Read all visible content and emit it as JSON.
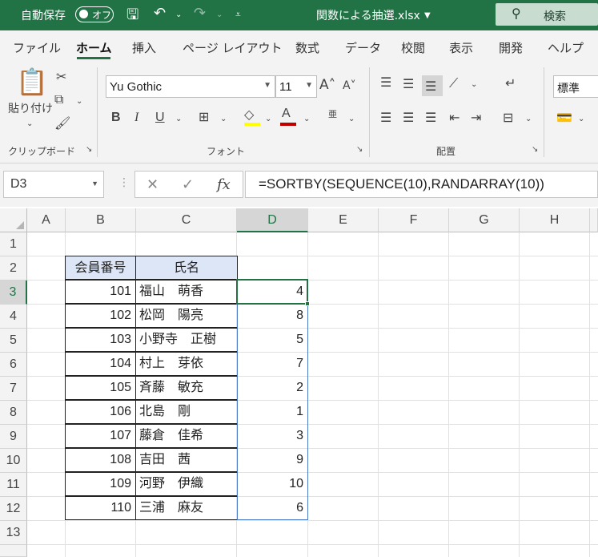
{
  "titlebar": {
    "autosave_label": "自動保存",
    "toggle_label": "オフ",
    "filename": "関数による抽選.xlsx",
    "search_label": "検索"
  },
  "menu": {
    "tabs": [
      "ファイル",
      "ホーム",
      "挿入",
      "ページ レイアウト",
      "数式",
      "データ",
      "校閲",
      "表示",
      "開発",
      "ヘルプ"
    ],
    "active": "ホーム"
  },
  "ribbon": {
    "clipboard": {
      "paste_label": "貼り付け",
      "paste_label2": "け",
      "group_label": "クリップボード"
    },
    "font": {
      "family": "Yu Gothic",
      "size": "11",
      "bold": "B",
      "italic": "I",
      "underline": "U",
      "group_label": "フォント",
      "fill_color": "#ffff00",
      "font_color": "#c00000"
    },
    "alignment": {
      "group_label": "配置"
    },
    "number": {
      "format": "標準"
    }
  },
  "formula_bar": {
    "name_box": "D3",
    "formula": "=SORTBY(SEQUENCE(10),RANDARRAY(10))"
  },
  "sheet": {
    "columns": [
      "A",
      "B",
      "C",
      "D",
      "E",
      "F",
      "G",
      "H"
    ],
    "selected_column": "D",
    "rows": [
      "1",
      "2",
      "3",
      "4",
      "5",
      "6",
      "7",
      "8",
      "9",
      "10",
      "11",
      "12",
      "13"
    ],
    "selected_row": "3",
    "table_headers": {
      "id": "会員番号",
      "name": "氏名"
    },
    "members": [
      {
        "id": "101",
        "name": "福山　萌香",
        "d": "4"
      },
      {
        "id": "102",
        "name": "松岡　陽亮",
        "d": "8"
      },
      {
        "id": "103",
        "name": "小野寺　正樹",
        "d": "5"
      },
      {
        "id": "104",
        "name": "村上　芽依",
        "d": "7"
      },
      {
        "id": "105",
        "name": "斉藤　敏充",
        "d": "2"
      },
      {
        "id": "106",
        "name": "北島　剛",
        "d": "1"
      },
      {
        "id": "107",
        "name": "藤倉　佳希",
        "d": "3"
      },
      {
        "id": "108",
        "name": "吉田　茜",
        "d": "9"
      },
      {
        "id": "109",
        "name": "河野　伊織",
        "d": "10"
      },
      {
        "id": "110",
        "name": "三浦　麻友",
        "d": "6"
      }
    ],
    "header_fill": "#dde6f7",
    "accent": "#217346"
  }
}
